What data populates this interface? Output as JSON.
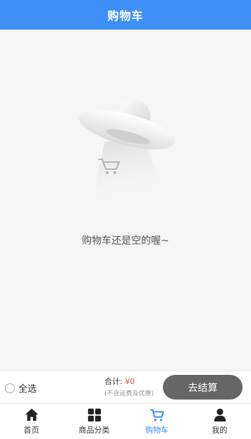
{
  "header": {
    "title": "购物车"
  },
  "empty": {
    "message": "购物车还是空的喔~",
    "illustration": "ufo-cart-icon"
  },
  "checkout_bar": {
    "select_all_label": "全选",
    "total_label": "合计:",
    "total_value": "¥0",
    "total_note": "(不含运费及优惠)",
    "checkout_label": "去结算"
  },
  "tabbar": {
    "items": [
      {
        "label": "首页",
        "icon": "home-icon"
      },
      {
        "label": "商品分类",
        "icon": "grid-icon"
      },
      {
        "label": "购物车",
        "icon": "cart-icon",
        "active": true
      },
      {
        "label": "我的",
        "icon": "user-icon"
      }
    ]
  },
  "colors": {
    "primary": "#3d8ff5",
    "price": "#e54b3c",
    "button": "#666666"
  }
}
